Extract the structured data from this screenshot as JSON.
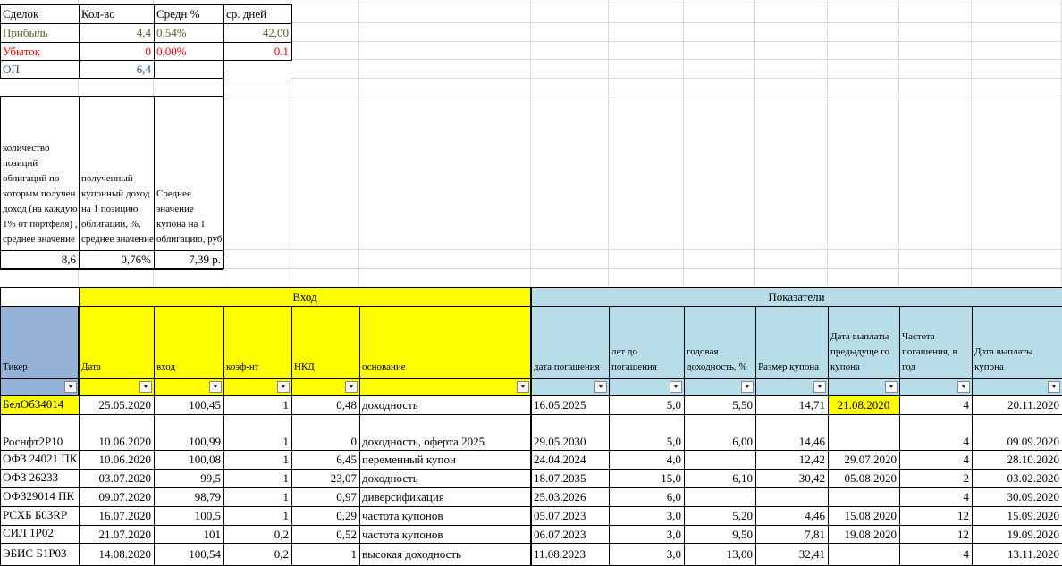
{
  "summary": {
    "headers": [
      "Сделок",
      "Кол-во",
      "Средн %",
      "ср. дней"
    ],
    "rows": [
      {
        "label": "Прибыль",
        "count": "4,4",
        "pct": "0,54%",
        "days": "42,00",
        "color": "#4f6228"
      },
      {
        "label": "Убыток",
        "count": "0",
        "pct": "0,00%",
        "days": "0.1",
        "color": "#ff0000"
      },
      {
        "label": "ОП",
        "count": "6,4",
        "pct": "",
        "days": "",
        "color": "#1f497d"
      }
    ]
  },
  "stats": {
    "headers": [
      "количество позиций облигаций по которым получен доход (на каждую 1% от портфеля) , среднее значение",
      "полученный купонный доход на 1 позицию облигаций, %, среднее значение",
      "Среднее значение купона на 1 облигацию, руб"
    ],
    "values": [
      "8,6",
      "0,76%",
      "7,39 р."
    ]
  },
  "groups": {
    "entry": "Вход",
    "indicators": "Показатели"
  },
  "columns": [
    "Тикер",
    "Дата",
    "вход",
    "коэф-нт",
    "НКД",
    "основание",
    "дата погашения",
    "лет до погашения",
    "годовая доходность, %",
    "Размер купона",
    "Дата выплаты предыдуще го купона",
    "Частота погашения, в год",
    "Дата выплаты купона"
  ],
  "filter_icon": "filter-dropdown-icon",
  "colors": {
    "yellow": "#ffff00",
    "lightblue": "#b7dde8",
    "tickerblue": "#95b3d7",
    "highlight": "#ffff00",
    "grid": "#dadada"
  },
  "rows": [
    {
      "ticker": "БелОб34014",
      "date": "25.05.2020",
      "entry": "100,45",
      "coef": "1",
      "nkd": "0,48",
      "reason": "доходность",
      "maturity": "16.05.2025",
      "years": "5,0",
      "yield": "5,50",
      "coupon": "14,71",
      "prev": "21.08.2020",
      "freq": "4",
      "next": "20.11.2020",
      "hl": true
    },
    {
      "ticker": "Роснфт2Р10",
      "date": "10.06.2020",
      "entry": "100,99",
      "coef": "1",
      "nkd": "0",
      "reason": "доходность, оферта 2025",
      "maturity": "29.05.2030",
      "years": "5,0",
      "yield": "6,00",
      "coupon": "14,46",
      "prev": "",
      "freq": "4",
      "next": "09.09.2020"
    },
    {
      "ticker": "ОФЗ 24021 ПК",
      "date": "10.06.2020",
      "entry": "100,08",
      "coef": "1",
      "nkd": "6,45",
      "reason": "переменный купон",
      "maturity": "24.04.2024",
      "years": "4,0",
      "yield": "",
      "coupon": "12,42",
      "prev": "29.07.2020",
      "freq": "4",
      "next": "28.10.2020"
    },
    {
      "ticker": "ОФЗ 26233",
      "date": "03.07.2020",
      "entry": "99,5",
      "coef": "1",
      "nkd": "23,07",
      "reason": "доходность",
      "maturity": "18.07.2035",
      "years": "15,0",
      "yield": "6,10",
      "coupon": "30,42",
      "prev": "05.08.2020",
      "freq": "2",
      "next": "03.02.2020"
    },
    {
      "ticker": "ОФЗ29014 ПК",
      "date": "09.07.2020",
      "entry": "98,79",
      "coef": "1",
      "nkd": "0,97",
      "reason": "диверсификация",
      "maturity": "25.03.2026",
      "years": "6,0",
      "yield": "",
      "coupon": "",
      "prev": "",
      "freq": "4",
      "next": "30.09.2020"
    },
    {
      "ticker": "РСХБ Б03RP",
      "date": "16.07.2020",
      "entry": "100,5",
      "coef": "1",
      "nkd": "0,29",
      "reason": "частота купонов",
      "maturity": "05.07.2023",
      "years": "3,0",
      "yield": "5,20",
      "coupon": "4,46",
      "prev": "15.08.2020",
      "freq": "12",
      "next": "15.09.2020"
    },
    {
      "ticker": "СИЛ 1Р02",
      "date": "21.07.2020",
      "entry": "101",
      "coef": "0,2",
      "nkd": "0,52",
      "reason": "частота купонов",
      "maturity": "06.07.2023",
      "years": "3,0",
      "yield": "9,50",
      "coupon": "7,81",
      "prev": "19.08.2020",
      "freq": "12",
      "next": "19.09.2020"
    },
    {
      "ticker": "ЭБИС Б1Р03",
      "date": "14.08.2020",
      "entry": "100,54",
      "coef": "0,2",
      "nkd": "1",
      "reason": "высокая доходность",
      "maturity": "11.08.2023",
      "years": "3,0",
      "yield": "13,00",
      "coupon": "32,41",
      "prev": "",
      "freq": "4",
      "next": "13.11.2020"
    }
  ]
}
